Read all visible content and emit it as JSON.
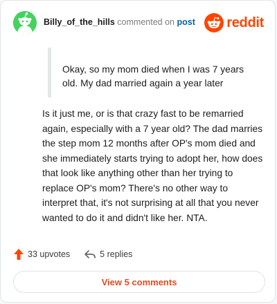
{
  "comment": {
    "username": "Billy_of_the_hills",
    "action_text": "commented on",
    "post_link_label": "post",
    "quote": "Okay, so my mom died when I was 7 years old. My dad married again a year later",
    "body": "Is it just me, or is that crazy fast to be remarried again, especially with a 7 year old? The dad marries the step mom 12 months after OP's mom died and she immediately starts trying to adopt her, how does that look like anything other than her trying to replace OP's mom? There's no other way to interpret that, it's not surprising at all that you never wanted to do it and didn't like her. NTA.",
    "upvotes_label": "33 upvotes",
    "replies_label": "5 replies",
    "view_comments_label": "View 5 comments"
  },
  "brand": {
    "wordmark": "reddit",
    "logo_icon": "reddit-alien-icon",
    "accent_color": "#ff4500"
  },
  "avatar": {
    "icon": "snoo-avatar-icon",
    "background_color": "#46d160"
  }
}
